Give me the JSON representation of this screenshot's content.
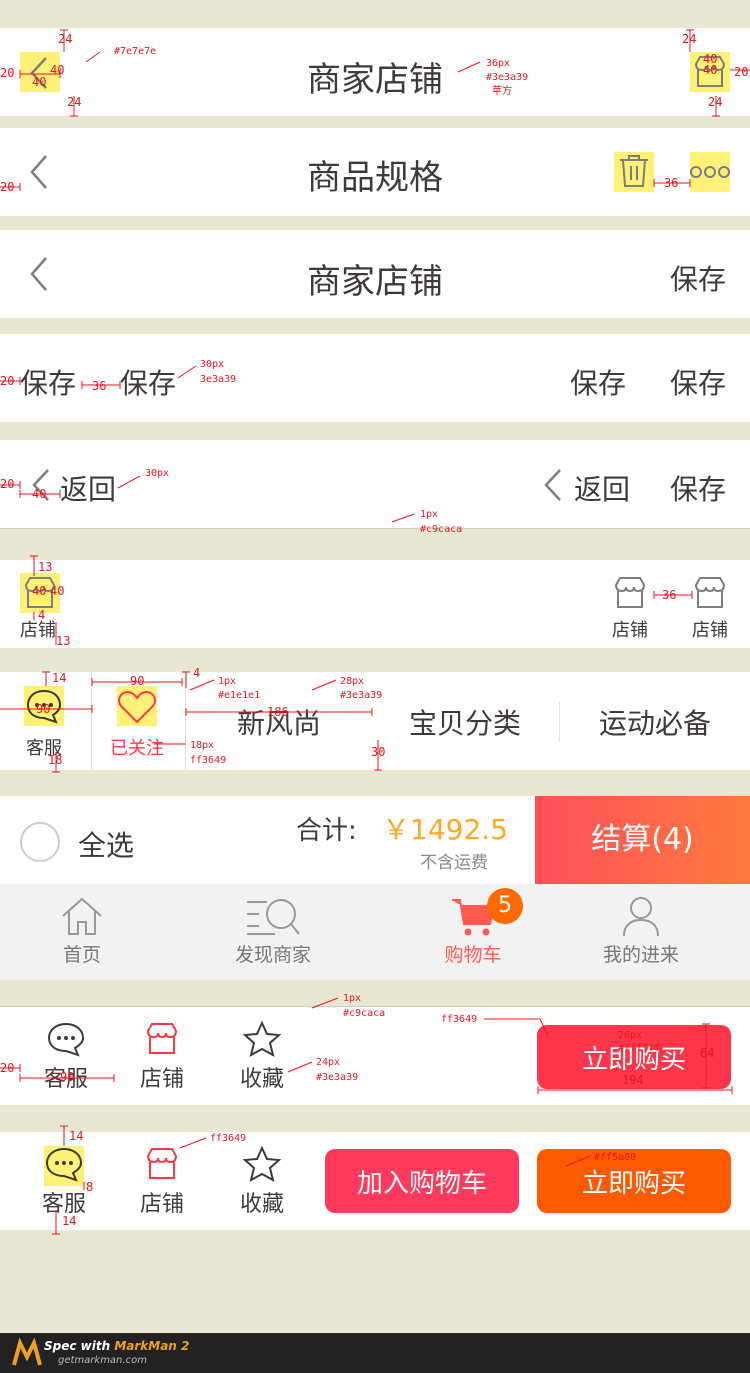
{
  "bar1": {
    "title": "商家店铺"
  },
  "bar2": {
    "title": "商品规格"
  },
  "bar3": {
    "title": "商家店铺",
    "save": "保存"
  },
  "bar4": {
    "save1": "保存",
    "save2": "保存",
    "save3": "保存",
    "save4": "保存"
  },
  "bar5": {
    "back1": "返回",
    "back2": "返回",
    "save": "保存"
  },
  "bar6": {
    "shop1": "店铺",
    "shop2": "店铺",
    "shop3": "店铺"
  },
  "bar7": {
    "service": "客服",
    "followed": "已关注",
    "tab1": "新风尚",
    "tab2": "宝贝分类",
    "tab3": "运动必备"
  },
  "cart": {
    "select_all": "全选",
    "total_label": "合计:",
    "total": "￥1492.5",
    "shipping": "不含运费",
    "checkout": "结算(4)"
  },
  "tabbar": {
    "home": "首页",
    "discover": "发现商家",
    "cart": "购物车",
    "cart_badge": "5",
    "me": "我的进来"
  },
  "buy1": {
    "service": "客服",
    "shop": "店铺",
    "fav": "收藏",
    "buy": "立即购买"
  },
  "buy2": {
    "service": "客服",
    "shop": "店铺",
    "fav": "收藏",
    "add_cart": "加入购物车",
    "buy": "立即购买"
  },
  "annotations": {
    "a24a": "24",
    "a20a": "20",
    "a40a": "40",
    "a40b": "40",
    "a24b": "24",
    "c7e": "#7e7e7e",
    "px36": "36px",
    "c3e": "#3e3a39",
    "font": "苹方",
    "a24c": "24",
    "a40c": "40",
    "a40d": "40",
    "a20b": "20",
    "a24d": "24",
    "a20c": "20",
    "a36a": "36",
    "a20d": "20",
    "a36b": "36",
    "px30a": "30px",
    "c3e2": "3e3a39",
    "a20e": "20",
    "a40e": "40",
    "px30b": "30px",
    "px1a": "1px",
    "cc9": "#c9caca",
    "a13a": "13",
    "a40f": "40",
    "a40g": "40",
    "a4a": "4",
    "a13b": "13",
    "a36c": "36",
    "a14a": "14",
    "a90a": "90",
    "a90b": "90",
    "a18a": "18",
    "a4b": "4",
    "px1b": "1px",
    "ce1": "#e1e1e1",
    "a186": "186",
    "px28": "28px",
    "c3e3": "#3e3a39",
    "px18": "18px",
    "cff": "ff3649",
    "a30": "30",
    "px1c": "1px",
    "cc9b": "#c9caca",
    "cff2": "ff3649",
    "px26": "26px",
    "cfff": "#ffffff",
    "a64": "64",
    "a20f": "20",
    "a90c": "90",
    "px24": "24px",
    "c3e4": "#3e3a39",
    "a194": "194",
    "a14b": "14",
    "a8": "8",
    "a14c": "14",
    "cff3": "ff3649",
    "cf5": "#ff5a00"
  },
  "footer": {
    "brand1": "Spec with ",
    "brand2": "MarkMan 2",
    "site": "getmarkman.com"
  }
}
